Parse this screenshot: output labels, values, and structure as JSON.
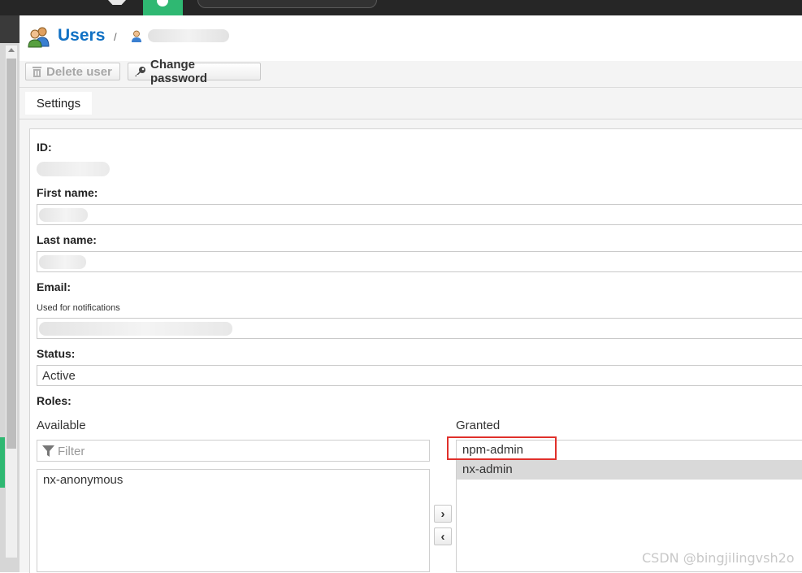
{
  "header": {
    "title": "Users",
    "separator": "/",
    "user_name": ""
  },
  "toolbar": {
    "delete_label": "Delete user",
    "change_password_label": "Change password"
  },
  "tabs": [
    {
      "label": "Settings"
    }
  ],
  "form": {
    "id_label": "ID:",
    "first_name_label": "First name:",
    "last_name_label": "Last name:",
    "email_label": "Email:",
    "email_help": "Used for notifications",
    "status_label": "Status:",
    "status_value": "Active",
    "roles_label": "Roles:"
  },
  "roles": {
    "available_label": "Available",
    "granted_label": "Granted",
    "filter_placeholder": "Filter",
    "available": [
      "nx-anonymous"
    ],
    "granted": [
      "npm-admin",
      "nx-admin"
    ],
    "move_right": "›",
    "move_left": "‹"
  },
  "watermark": "CSDN @bingjilingvsh2o",
  "colors": {
    "accent": "#1171c4",
    "nav_active": "#2fb872",
    "highlight_box": "#e0302b"
  }
}
